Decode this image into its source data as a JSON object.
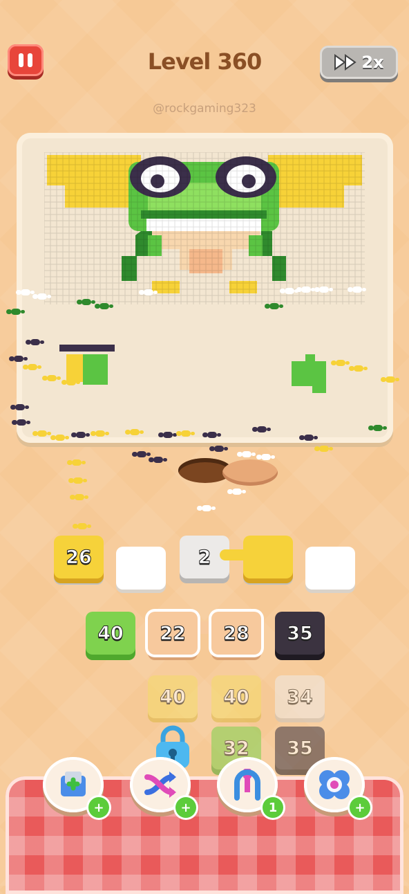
{
  "header": {
    "pause_icon": "pause-icon",
    "level_title": "Level 360",
    "speed_label": "2x",
    "speed_icon": "fast-forward-icon"
  },
  "watermark": "@rockgaming323",
  "board": {
    "artwork": "pixel-frog",
    "colors": {
      "yellow": "#f7d238",
      "green": "#5bc443",
      "dark_green": "#2f8a2d",
      "purple": "#3b2f4a",
      "white": "#ffffff",
      "peach": "#f8c9a0"
    }
  },
  "queue_slots": [
    {
      "value": "26",
      "color": "yellow"
    },
    {
      "value": "",
      "color": "empty"
    },
    {
      "value": "2",
      "color": "white"
    },
    {
      "value": "",
      "color": "yellow"
    },
    {
      "value": "",
      "color": "empty"
    }
  ],
  "stack_rows": [
    [
      {
        "value": "40",
        "color": "green"
      },
      {
        "value": "22",
        "color": "peach"
      },
      {
        "value": "28",
        "color": "peach"
      },
      {
        "value": "35",
        "color": "dark"
      }
    ],
    [
      {
        "value": "40",
        "color": "lemon"
      },
      {
        "value": "40",
        "color": "lemon"
      },
      {
        "value": "34",
        "color": "light"
      }
    ],
    [
      {
        "value": "32",
        "color": "green"
      },
      {
        "value": "35",
        "color": "dark"
      }
    ]
  ],
  "boosters": [
    {
      "name": "add-slot",
      "icon": "add-box-icon",
      "badge": "+"
    },
    {
      "name": "shuffle",
      "icon": "shuffle-arrows-icon",
      "badge": "+"
    },
    {
      "name": "magnet-claw",
      "icon": "claw-icon",
      "badge": "1"
    },
    {
      "name": "blossom",
      "icon": "flower-icon",
      "badge": "+"
    }
  ]
}
